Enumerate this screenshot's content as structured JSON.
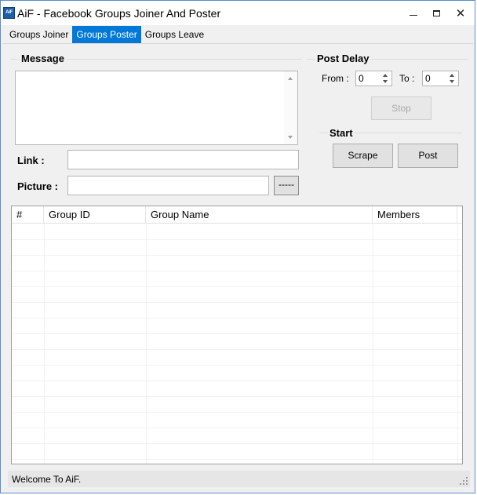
{
  "window": {
    "icon_text": "AiF",
    "title": "AiF - Facebook Groups Joiner And Poster"
  },
  "tabs": [
    {
      "label": "Groups Joiner"
    },
    {
      "label": "Groups Poster"
    },
    {
      "label": "Groups Leave"
    }
  ],
  "message": {
    "group_label": "Message",
    "text": "",
    "link_label": "Link :",
    "link_value": "",
    "picture_label": "Picture :",
    "picture_value": "",
    "browse_label": "-----"
  },
  "post_delay": {
    "group_label": "Post Delay",
    "from_label": "From :",
    "from_value": "0",
    "to_label": "To :",
    "to_value": "0",
    "stop_label": "Stop"
  },
  "start": {
    "group_label": "Start",
    "scrape_label": "Scrape",
    "post_label": "Post"
  },
  "table": {
    "columns": [
      "#",
      "Group ID",
      "Group Name",
      "Members"
    ],
    "rows": []
  },
  "status": {
    "text": "Welcome To AiF."
  },
  "colors": {
    "accent": "#0078d7",
    "window_border": "#5a8fc9"
  }
}
